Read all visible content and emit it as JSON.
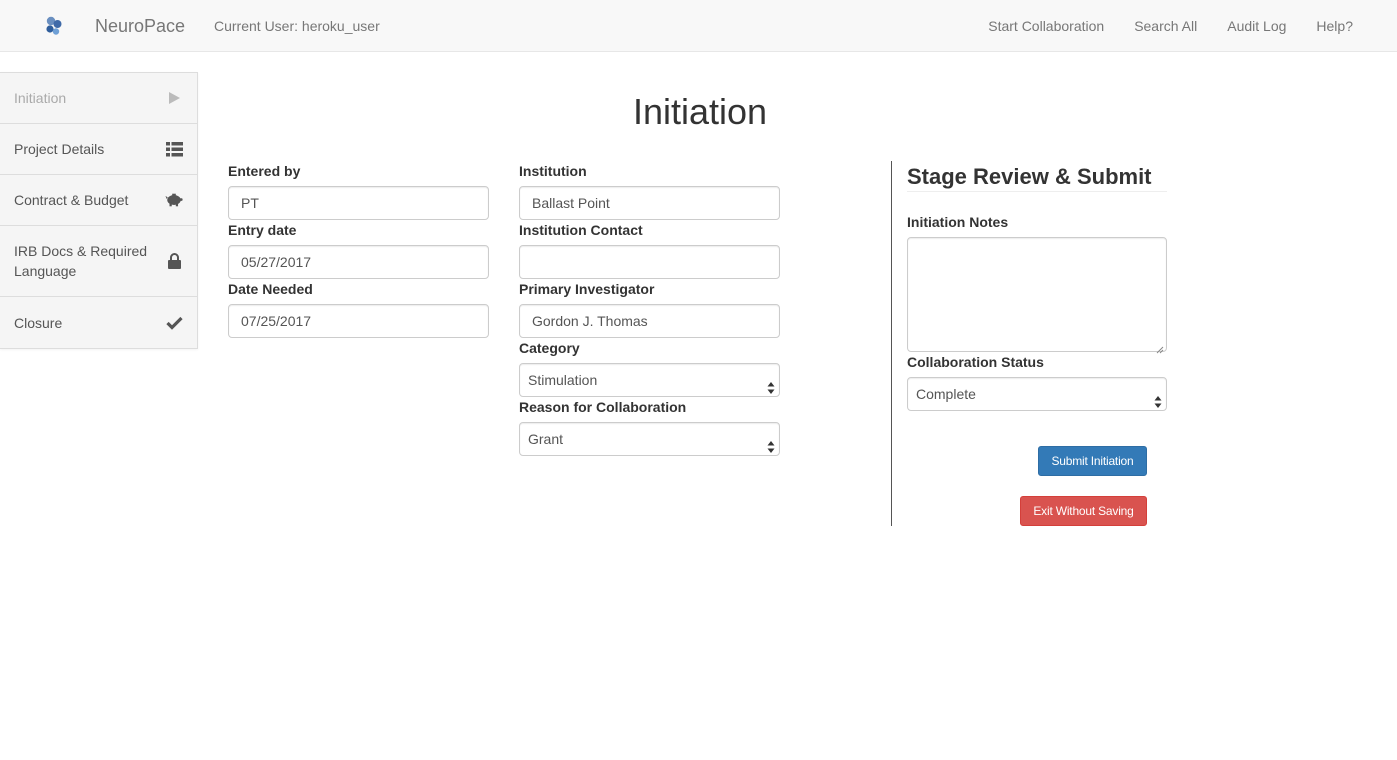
{
  "navbar": {
    "brand": "NeuroPace",
    "current_user": "Current User: heroku_user",
    "links": [
      "Start Collaboration",
      "Search All",
      "Audit Log",
      "Help?"
    ]
  },
  "sidebar": {
    "items": [
      {
        "label": "Initiation",
        "icon": "play-icon",
        "active": true
      },
      {
        "label": "Project Details",
        "icon": "list-icon",
        "active": false
      },
      {
        "label": "Contract & Budget",
        "icon": "piggy-bank-icon",
        "active": false
      },
      {
        "label": "IRB Docs & Required Language",
        "icon": "lock-icon",
        "active": false
      },
      {
        "label": "Closure",
        "icon": "checkmark-icon",
        "active": false
      }
    ]
  },
  "page": {
    "title": "Initiation"
  },
  "form": {
    "entered_by": {
      "label": "Entered by",
      "value": "PT"
    },
    "entry_date": {
      "label": "Entry date",
      "value": "05/27/2017"
    },
    "date_needed": {
      "label": "Date Needed",
      "value": "07/25/2017"
    },
    "institution": {
      "label": "Institution",
      "value": "Ballast Point"
    },
    "institution_contact": {
      "label": "Institution Contact",
      "value": ""
    },
    "primary_investigator": {
      "label": "Primary Investigator",
      "value": "Gordon J. Thomas"
    },
    "category": {
      "label": "Category",
      "value": "Stimulation"
    },
    "reason": {
      "label": "Reason for Collaboration",
      "value": "Grant"
    }
  },
  "review": {
    "title": "Stage Review & Submit",
    "notes_label": "Initiation Notes",
    "notes_value": "",
    "status_label": "Collaboration Status",
    "status_value": "Complete",
    "submit_label": "Submit Initiation",
    "exit_label": "Exit Without Saving"
  },
  "colors": {
    "primary": "#337ab7",
    "danger": "#d9534f",
    "navbar_bg": "#f8f8f8",
    "sidebar_bg": "#f5f5f5"
  }
}
